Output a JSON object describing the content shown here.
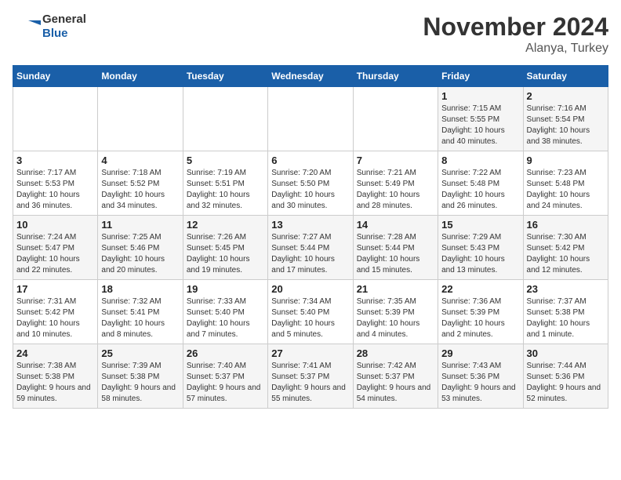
{
  "header": {
    "logo_line1": "General",
    "logo_line2": "Blue",
    "month_title": "November 2024",
    "location": "Alanya, Turkey"
  },
  "weekdays": [
    "Sunday",
    "Monday",
    "Tuesday",
    "Wednesday",
    "Thursday",
    "Friday",
    "Saturday"
  ],
  "weeks": [
    [
      {
        "day": "",
        "info": ""
      },
      {
        "day": "",
        "info": ""
      },
      {
        "day": "",
        "info": ""
      },
      {
        "day": "",
        "info": ""
      },
      {
        "day": "",
        "info": ""
      },
      {
        "day": "1",
        "info": "Sunrise: 7:15 AM\nSunset: 5:55 PM\nDaylight: 10 hours and 40 minutes."
      },
      {
        "day": "2",
        "info": "Sunrise: 7:16 AM\nSunset: 5:54 PM\nDaylight: 10 hours and 38 minutes."
      }
    ],
    [
      {
        "day": "3",
        "info": "Sunrise: 7:17 AM\nSunset: 5:53 PM\nDaylight: 10 hours and 36 minutes."
      },
      {
        "day": "4",
        "info": "Sunrise: 7:18 AM\nSunset: 5:52 PM\nDaylight: 10 hours and 34 minutes."
      },
      {
        "day": "5",
        "info": "Sunrise: 7:19 AM\nSunset: 5:51 PM\nDaylight: 10 hours and 32 minutes."
      },
      {
        "day": "6",
        "info": "Sunrise: 7:20 AM\nSunset: 5:50 PM\nDaylight: 10 hours and 30 minutes."
      },
      {
        "day": "7",
        "info": "Sunrise: 7:21 AM\nSunset: 5:49 PM\nDaylight: 10 hours and 28 minutes."
      },
      {
        "day": "8",
        "info": "Sunrise: 7:22 AM\nSunset: 5:48 PM\nDaylight: 10 hours and 26 minutes."
      },
      {
        "day": "9",
        "info": "Sunrise: 7:23 AM\nSunset: 5:48 PM\nDaylight: 10 hours and 24 minutes."
      }
    ],
    [
      {
        "day": "10",
        "info": "Sunrise: 7:24 AM\nSunset: 5:47 PM\nDaylight: 10 hours and 22 minutes."
      },
      {
        "day": "11",
        "info": "Sunrise: 7:25 AM\nSunset: 5:46 PM\nDaylight: 10 hours and 20 minutes."
      },
      {
        "day": "12",
        "info": "Sunrise: 7:26 AM\nSunset: 5:45 PM\nDaylight: 10 hours and 19 minutes."
      },
      {
        "day": "13",
        "info": "Sunrise: 7:27 AM\nSunset: 5:44 PM\nDaylight: 10 hours and 17 minutes."
      },
      {
        "day": "14",
        "info": "Sunrise: 7:28 AM\nSunset: 5:44 PM\nDaylight: 10 hours and 15 minutes."
      },
      {
        "day": "15",
        "info": "Sunrise: 7:29 AM\nSunset: 5:43 PM\nDaylight: 10 hours and 13 minutes."
      },
      {
        "day": "16",
        "info": "Sunrise: 7:30 AM\nSunset: 5:42 PM\nDaylight: 10 hours and 12 minutes."
      }
    ],
    [
      {
        "day": "17",
        "info": "Sunrise: 7:31 AM\nSunset: 5:42 PM\nDaylight: 10 hours and 10 minutes."
      },
      {
        "day": "18",
        "info": "Sunrise: 7:32 AM\nSunset: 5:41 PM\nDaylight: 10 hours and 8 minutes."
      },
      {
        "day": "19",
        "info": "Sunrise: 7:33 AM\nSunset: 5:40 PM\nDaylight: 10 hours and 7 minutes."
      },
      {
        "day": "20",
        "info": "Sunrise: 7:34 AM\nSunset: 5:40 PM\nDaylight: 10 hours and 5 minutes."
      },
      {
        "day": "21",
        "info": "Sunrise: 7:35 AM\nSunset: 5:39 PM\nDaylight: 10 hours and 4 minutes."
      },
      {
        "day": "22",
        "info": "Sunrise: 7:36 AM\nSunset: 5:39 PM\nDaylight: 10 hours and 2 minutes."
      },
      {
        "day": "23",
        "info": "Sunrise: 7:37 AM\nSunset: 5:38 PM\nDaylight: 10 hours and 1 minute."
      }
    ],
    [
      {
        "day": "24",
        "info": "Sunrise: 7:38 AM\nSunset: 5:38 PM\nDaylight: 9 hours and 59 minutes."
      },
      {
        "day": "25",
        "info": "Sunrise: 7:39 AM\nSunset: 5:38 PM\nDaylight: 9 hours and 58 minutes."
      },
      {
        "day": "26",
        "info": "Sunrise: 7:40 AM\nSunset: 5:37 PM\nDaylight: 9 hours and 57 minutes."
      },
      {
        "day": "27",
        "info": "Sunrise: 7:41 AM\nSunset: 5:37 PM\nDaylight: 9 hours and 55 minutes."
      },
      {
        "day": "28",
        "info": "Sunrise: 7:42 AM\nSunset: 5:37 PM\nDaylight: 9 hours and 54 minutes."
      },
      {
        "day": "29",
        "info": "Sunrise: 7:43 AM\nSunset: 5:36 PM\nDaylight: 9 hours and 53 minutes."
      },
      {
        "day": "30",
        "info": "Sunrise: 7:44 AM\nSunset: 5:36 PM\nDaylight: 9 hours and 52 minutes."
      }
    ]
  ]
}
